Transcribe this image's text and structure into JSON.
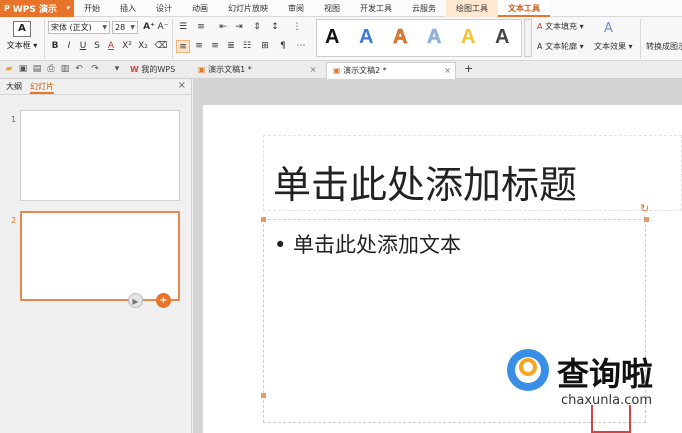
{
  "app": {
    "name": "WPS 演示",
    "logo": "P"
  },
  "menu": {
    "tabs": [
      "开始",
      "插入",
      "设计",
      "动画",
      "幻灯片放映",
      "审阅",
      "视图",
      "开发工具",
      "云服务",
      "绘图工具",
      "文本工具"
    ],
    "active_tab": "文本工具",
    "context_tab": "绘图工具"
  },
  "ribbon": {
    "textbox_label": "文本框",
    "font_name": "宋体 (正文)",
    "font_size": "28",
    "buttons_row2": [
      "B",
      "I",
      "U",
      "S",
      "A",
      "X²",
      "X₂"
    ],
    "gallery_letters": [
      "A",
      "A",
      "A",
      "A",
      "A",
      "A"
    ],
    "gallery_colors": [
      "#111111",
      "#3a7bd5",
      "#e07a2f",
      "#8fb2d9",
      "#f1c232",
      "#444444"
    ],
    "text_fill": "文本填充",
    "text_outline": "文本轮廓",
    "text_effect": "文本效果",
    "convert": "转换成图示"
  },
  "tabbar": {
    "tabs": [
      {
        "label": "我的WPS"
      },
      {
        "label": "演示文稿1 *"
      },
      {
        "label": "演示文稿2 *"
      }
    ],
    "active": "演示文稿2 *",
    "add": "+"
  },
  "leftpanel": {
    "tabs": [
      "大纲",
      "幻灯片"
    ],
    "active_tab": "幻灯片",
    "close": "×",
    "slides": [
      "1",
      "2"
    ],
    "selected": "2"
  },
  "slide": {
    "title_placeholder": "单击此处添加标题",
    "body_placeholder": "• 单击此处添加文本"
  },
  "watermark": {
    "cn": "查询啦",
    "en": "chaxunla.com"
  },
  "colors": {
    "accent": "#e8742a",
    "selection": "#e48a4d"
  }
}
